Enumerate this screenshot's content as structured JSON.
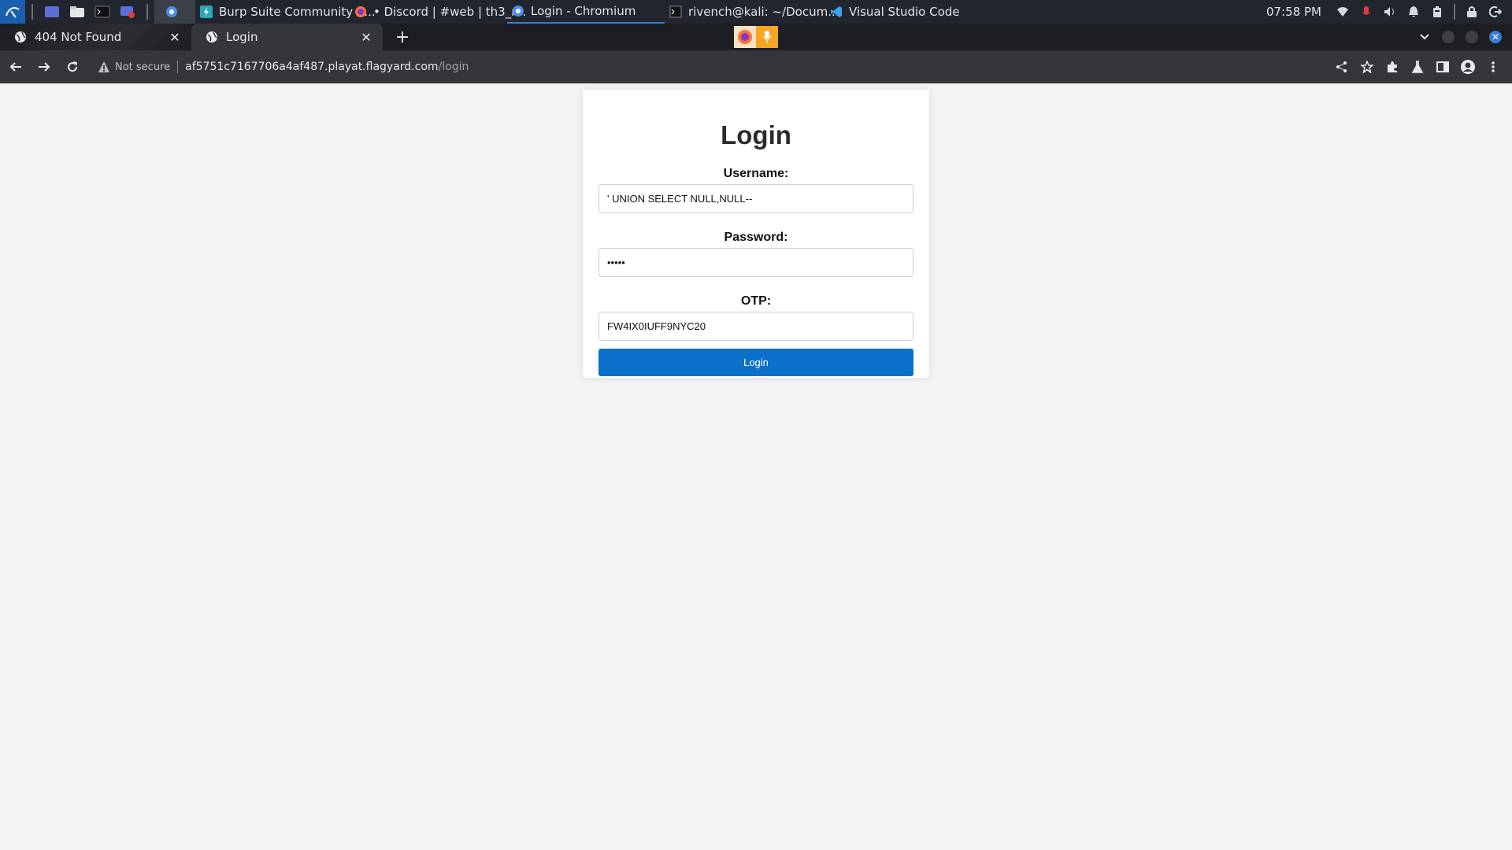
{
  "taskbar": {
    "windows": [
      {
        "label": "",
        "icon": "chromium-icon"
      },
      {
        "label": "Burp Suite Community E...",
        "icon": "burp-icon"
      },
      {
        "label": "• Discord | #web | th3_r...",
        "icon": "firefox-icon"
      },
      {
        "label": "Login - Chromium",
        "icon": "chromium-icon"
      },
      {
        "label": "rivench@kali: ~/Docum...",
        "icon": "terminal-icon"
      },
      {
        "label": "Visual Studio Code",
        "icon": "vscode-icon"
      }
    ],
    "clock": "07:58 PM"
  },
  "browser": {
    "tabs": [
      {
        "label": "404 Not Found",
        "active": false
      },
      {
        "label": "Login",
        "active": true
      }
    ],
    "close_glyph": "✕",
    "new_tab_glyph": "+",
    "security_label": "Not secure",
    "url_host": "af5751c7167706a4af487.playat.flagyard.com",
    "url_path": "/login"
  },
  "login": {
    "title": "Login",
    "username_label": "Username:",
    "username_value": "' UNION SELECT NULL,NULL--",
    "password_label": "Password:",
    "password_value": "•••••",
    "otp_label": "OTP:",
    "otp_value": "FW4IX0IUFF9NYC20",
    "button_label": "Login"
  },
  "colors": {
    "taskbar_bg": "#21252d",
    "tabstrip_bg": "#1c1e22",
    "toolbar_bg": "#35363a",
    "page_bg": "#f4f4f4",
    "accent": "#0a70c9"
  }
}
